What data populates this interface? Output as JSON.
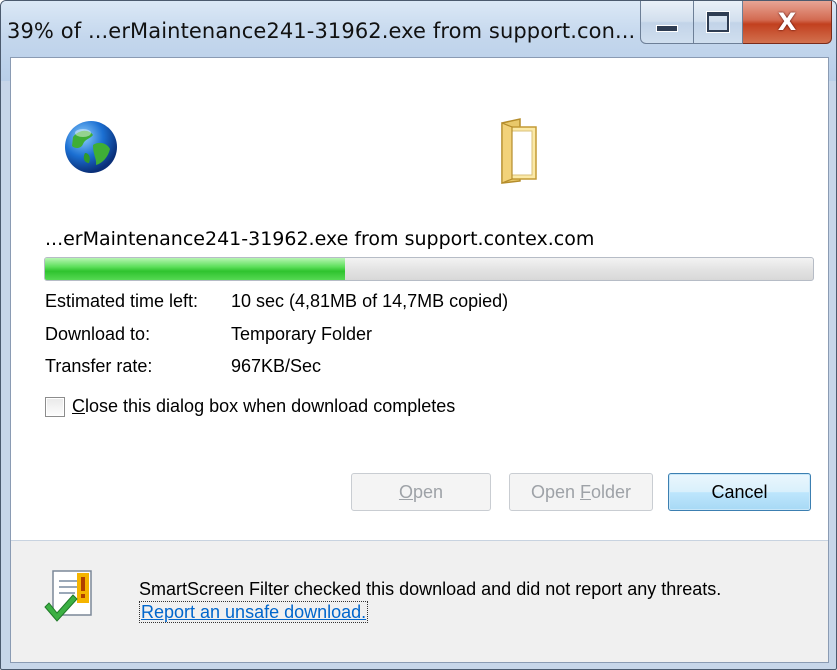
{
  "window": {
    "title": "39% of ...erMaintenance241-31962.exe from support.con...",
    "controls": {
      "minimize": "minimize",
      "maximize": "maximize",
      "close": "X"
    }
  },
  "download": {
    "filename": "...erMaintenance241-31962.exe from support.contex.com",
    "progress_percent": 39,
    "fields": {
      "estimated_label": "Estimated time left:",
      "estimated_value": "10 sec (4,81MB of 14,7MB copied)",
      "download_to_label": "Download to:",
      "download_to_value": "Temporary Folder",
      "transfer_rate_label": "Transfer rate:",
      "transfer_rate_value": "967KB/Sec"
    },
    "checkbox": {
      "label_prefix": "C",
      "label_rest": "lose this dialog box when download completes",
      "checked": false
    }
  },
  "buttons": {
    "open_prefix": "O",
    "open_rest": "pen",
    "open_folder_prefix": "Open ",
    "open_folder_u": "F",
    "open_folder_rest": "older",
    "cancel": "Cancel"
  },
  "smartscreen": {
    "message": "SmartScreen Filter checked this download and did not report any threats.",
    "link": "Report an unsafe download."
  },
  "icons": {
    "globe": "globe-icon",
    "folder": "folder-icon",
    "smartscreen": "smartscreen-shield-icon"
  },
  "colors": {
    "progress_fill": "#3ccc3a",
    "link": "#0066cc",
    "titlebar": "#c4d7ed",
    "close_button": "#c2401f"
  }
}
